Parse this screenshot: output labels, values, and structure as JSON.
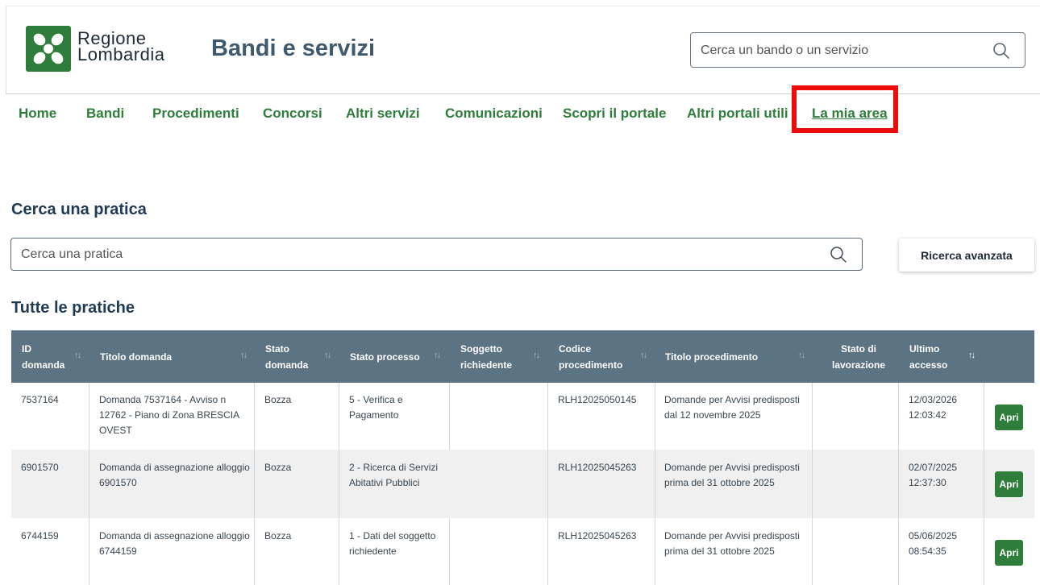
{
  "brand": {
    "logo_line1": "Regione",
    "logo_line2": "Lombardia",
    "site_title": "Bandi e servizi",
    "color": "#2f7d3a"
  },
  "top_search": {
    "placeholder": "Cerca un bando o un servizio",
    "icon": "search-icon"
  },
  "nav": {
    "items": [
      "Home",
      "Bandi",
      "Procedimenti",
      "Concorsi",
      "Altri servizi",
      "Comunicazioni",
      "Scopri il portale",
      "Altri portali utili",
      "La mia area"
    ],
    "active": "La mia area",
    "highlight_color": "#ee0b0b"
  },
  "search_section": {
    "title": "Cerca una pratica",
    "placeholder": "Cerca una pratica",
    "advanced_button": "Ricerca avanzata"
  },
  "table": {
    "title": "Tutte le pratiche",
    "header_color": "#5b7383",
    "columns": [
      {
        "line1": "ID",
        "line2": "domanda"
      },
      {
        "line1": "Titolo domanda",
        "line2": ""
      },
      {
        "line1": "Stato",
        "line2": "domanda"
      },
      {
        "line1": "Stato processo",
        "line2": ""
      },
      {
        "line1": "Soggetto",
        "line2": "richiedente"
      },
      {
        "line1": "Codice",
        "line2": "procedimento"
      },
      {
        "line1": "Titolo procedimento",
        "line2": ""
      },
      {
        "line1": "Stato di",
        "line2": "lavorazione"
      },
      {
        "line1": "Ultimo",
        "line2": "accesso"
      }
    ],
    "sort_icons": {
      "default": "↑↓",
      "active": "↑↓"
    },
    "action_label": "Apri",
    "rows": [
      {
        "id": "7537164",
        "titolo": [
          "Domanda 7537164 - Avviso n",
          "12762 - Piano di Zona BRESCIA",
          "OVEST"
        ],
        "stato_domanda": "Bozza",
        "stato_processo": [
          "5 - Verifica e",
          "Pagamento"
        ],
        "soggetto": "",
        "codice": "RLH12025050145",
        "titolo_proc": [
          "Domande per Avvisi predisposti",
          "dal 12 novembre 2025"
        ],
        "lavorazione": "",
        "accesso": [
          "12/03/2026",
          "12:03:42"
        ]
      },
      {
        "id": "6901570",
        "titolo": [
          "Domanda di assegnazione alloggio",
          "6901570"
        ],
        "stato_domanda": "Bozza",
        "stato_processo": [
          "2 - Ricerca di Servizi",
          "Abitativi Pubblici"
        ],
        "soggetto": "",
        "codice": "RLH12025045263",
        "titolo_proc": [
          "Domande per Avvisi predisposti",
          "prima del 31 ottobre 2025"
        ],
        "lavorazione": "",
        "accesso": [
          "02/07/2025",
          "12:37:30"
        ]
      },
      {
        "id": "6744159",
        "titolo": [
          "Domanda di assegnazione alloggio",
          "6744159"
        ],
        "stato_domanda": "Bozza",
        "stato_processo": [
          "1 - Dati del soggetto",
          "richiedente"
        ],
        "soggetto": "",
        "codice": "RLH12025045263",
        "titolo_proc": [
          "Domande per Avvisi predisposti",
          "prima del 31 ottobre 2025"
        ],
        "lavorazione": "",
        "accesso": [
          "05/06/2025",
          "08:54:35"
        ]
      }
    ]
  }
}
